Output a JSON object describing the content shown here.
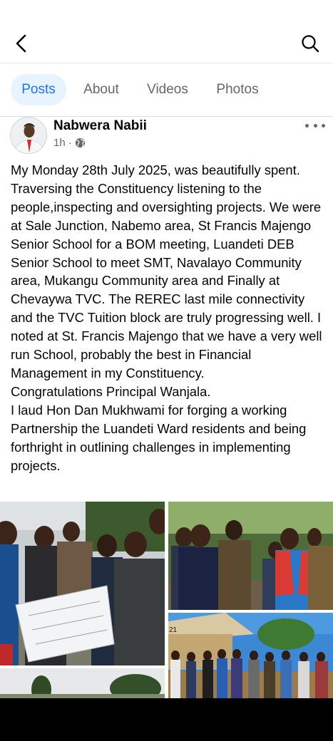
{
  "header": {
    "back_icon": "chevron-left-icon",
    "search_icon": "search-icon"
  },
  "tabs": [
    {
      "label": "Posts",
      "active": true
    },
    {
      "label": "About",
      "active": false
    },
    {
      "label": "Videos",
      "active": false
    },
    {
      "label": "Photos",
      "active": false
    }
  ],
  "post": {
    "author": "Nabwera Nabii",
    "time": "1h",
    "separator": "·",
    "privacy_icon": "globe-icon",
    "more_icon": "more-horizontal-icon",
    "text": "My Monday 28th July 2025, was beautifully spent. Traversing the Constituency listening to the people,inspecting and oversighting projects. We were at Sale Junction, Nabemo area, St Francis Majengo Senior School for a BOM meeting, Luandeti DEB Senior School to meet SMT, Navalayo Community area, Mukangu Community area and Finally at Chevaywa TVC. The REREC last mile connectivity and the TVC Tuition block are truly progressing well. I noted at St. Francis Majengo that we have a very well run School, probably the best in Financial Management in my Constituency.\nCongratulations Principal Wanjala.\nI laud Hon Dan Mukhwami for forging a working Partnership the Luandeti Ward residents and being forthright in outlining challenges in implementing projects.",
    "photo_overlay_number": "21"
  },
  "colors": {
    "accent": "#1877f2",
    "active_tab_bg": "#e7f3ff",
    "secondary_text": "#65676b"
  }
}
